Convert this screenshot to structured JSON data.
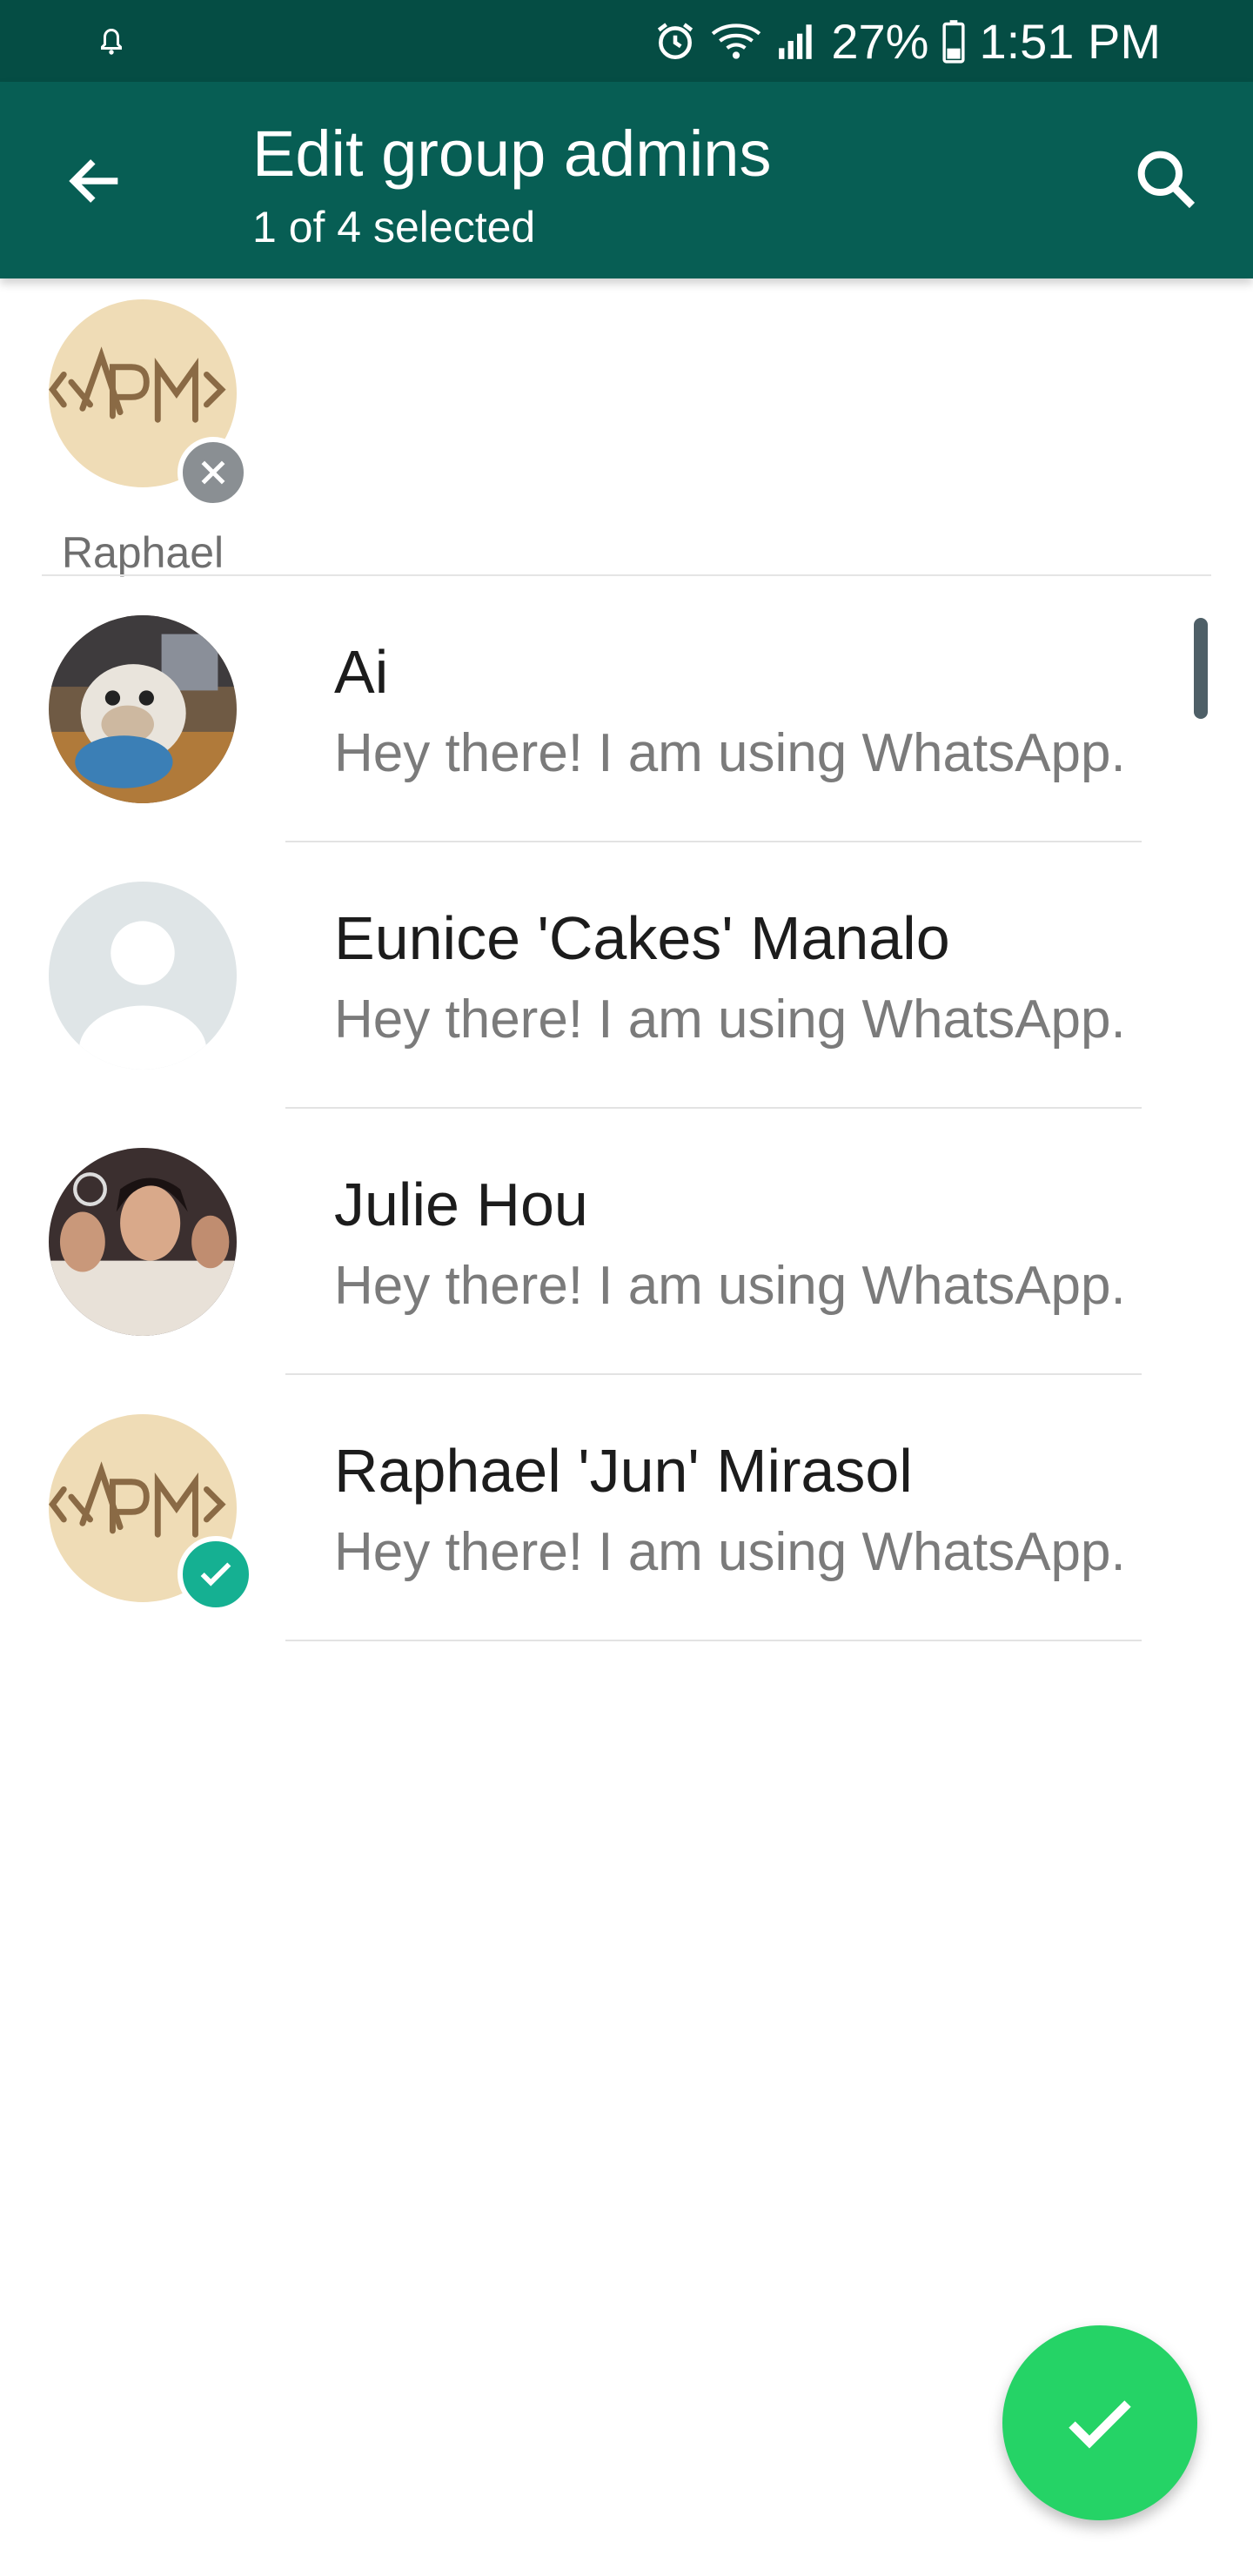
{
  "status_bar": {
    "battery_percent": "27%",
    "time": "1:51 PM",
    "icons": [
      "notification-bell-icon",
      "alarm-icon",
      "wifi-icon",
      "signal-icon",
      "battery-icon"
    ]
  },
  "app_bar": {
    "title": "Edit group admins",
    "subtitle": "1 of 4 selected",
    "back_icon": "arrow-back-icon",
    "search_icon": "search-icon"
  },
  "selected": [
    {
      "name": "Raphael",
      "avatar": "rpm-monogram"
    }
  ],
  "contacts": [
    {
      "name": "Ai",
      "status": "Hey there! I am using WhatsApp.",
      "avatar": "bulldog-photo",
      "selected": false
    },
    {
      "name": "Eunice 'Cakes' Manalo",
      "status": "Hey there! I am using WhatsApp.",
      "avatar": "default-avatar",
      "selected": false
    },
    {
      "name": "Julie Hou",
      "status": "Hey there! I am using WhatsApp.",
      "avatar": "people-photo",
      "selected": false
    },
    {
      "name": "Raphael 'Jun' Mirasol",
      "status": "Hey there! I am using WhatsApp.",
      "avatar": "rpm-monogram",
      "selected": true
    }
  ],
  "fab": {
    "icon": "check-icon"
  },
  "colors": {
    "status_bar": "#054d44",
    "app_bar": "#075e54",
    "fab": "#25d366",
    "selected_badge": "#15b092",
    "remove_badge": "#8a8f93"
  }
}
